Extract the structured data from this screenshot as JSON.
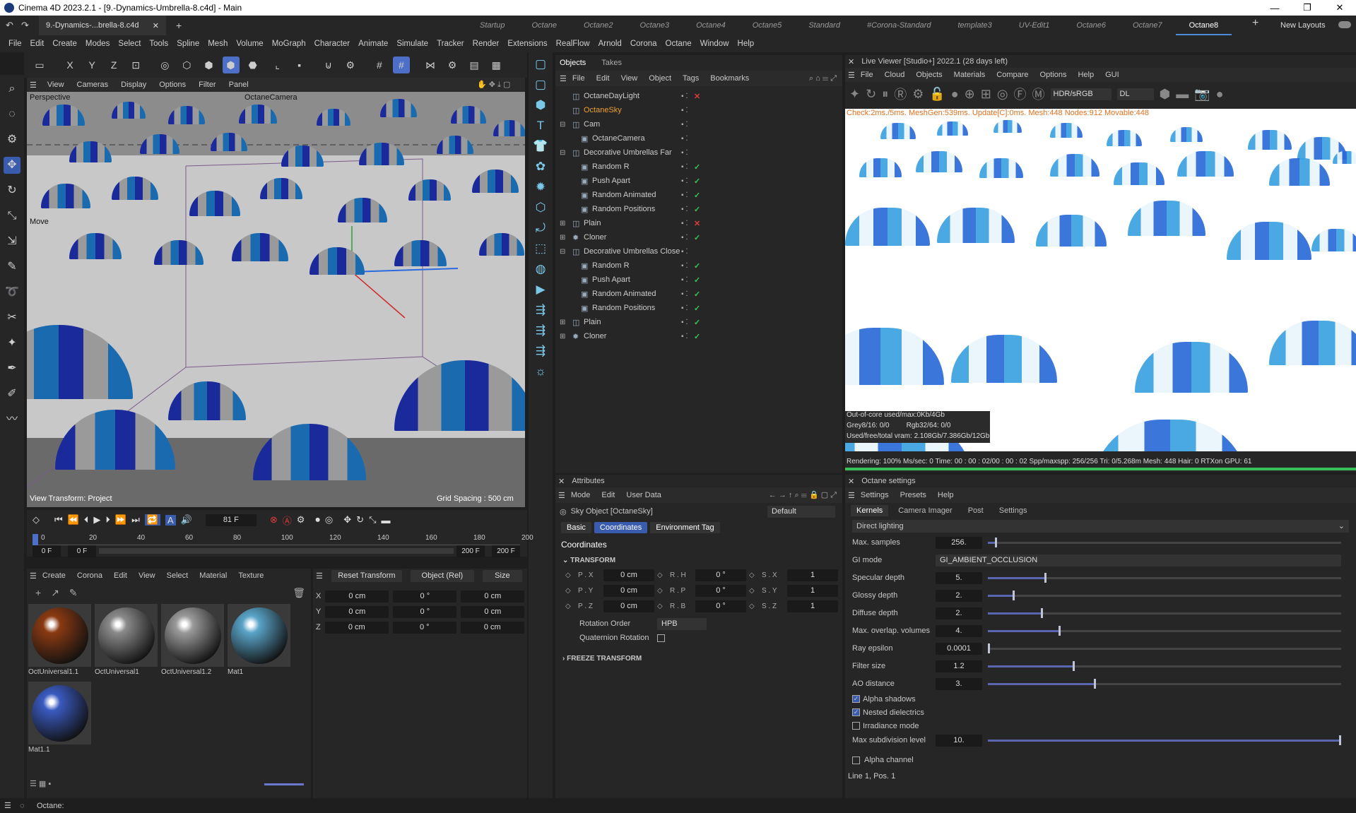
{
  "window": {
    "title": "Cinema 4D 2023.2.1 - [9.-Dynamics-Umbrella-8.c4d] - Main",
    "min": "—",
    "max": "❐",
    "close": "✕"
  },
  "doc_tab": {
    "label": "9.-Dynamics-...brella-8.c4d",
    "close": "✕",
    "add": "+"
  },
  "layout_tabs": [
    "Startup",
    "Octane",
    "Octane2",
    "Octane3",
    "Octane4",
    "Octane5",
    "Standard",
    "#Corona-Standard",
    "template3",
    "UV-Edit1",
    "Octane6",
    "Octane7",
    "Octane8"
  ],
  "layout_active": "Octane8",
  "new_layouts": "New Layouts",
  "menu": [
    "File",
    "Edit",
    "Create",
    "Modes",
    "Select",
    "Tools",
    "Spline",
    "Mesh",
    "Volume",
    "MoGraph",
    "Character",
    "Animate",
    "Simulate",
    "Tracker",
    "Render",
    "Extensions",
    "RealFlow",
    "Arnold",
    "Corona",
    "Octane",
    "Window",
    "Help"
  ],
  "viewport": {
    "menu": [
      "View",
      "Cameras",
      "Display",
      "Options",
      "Filter",
      "Panel"
    ],
    "name": "Perspective",
    "camera": "OctaneCamera",
    "mode": "Move",
    "transform": "View Transform: Project",
    "grid": "Grid Spacing : 500 cm"
  },
  "timeline": {
    "frame": "81 F",
    "ticks": [
      "0",
      "20",
      "40",
      "60",
      "80",
      "100",
      "120",
      "140",
      "160",
      "180",
      "200"
    ],
    "start": "0 F",
    "start2": "0 F",
    "end": "200 F",
    "end2": "200 F"
  },
  "material_menu": [
    "Create",
    "Corona",
    "Edit",
    "View",
    "Select",
    "Material",
    "Texture"
  ],
  "materials": [
    {
      "name": "OctUniversal1.1",
      "color": "#8a3a12"
    },
    {
      "name": "OctUniversal1",
      "color": "#8a8a8a"
    },
    {
      "name": "OctUniversal1.2",
      "color": "#9a9a9a"
    },
    {
      "name": "Mat1",
      "color": "#5aa4c8"
    },
    {
      "name": "Mat1.1",
      "color": "#3a5ac0"
    }
  ],
  "coords": {
    "reset": "Reset Transform",
    "mode": "Object (Rel)",
    "size": "Size",
    "rows": [
      {
        "axis": "X",
        "a": "0 cm",
        "b": "0 °",
        "c": "0 cm"
      },
      {
        "axis": "Y",
        "a": "0 cm",
        "b": "0 °",
        "c": "0 cm"
      },
      {
        "axis": "Z",
        "a": "0 cm",
        "b": "0 °",
        "c": "0 cm"
      }
    ]
  },
  "objects_panel": {
    "tabs": [
      "Objects",
      "Takes"
    ],
    "menu": [
      "File",
      "Edit",
      "View",
      "Object",
      "Tags",
      "Bookmarks"
    ],
    "items": [
      {
        "name": "OctaneDayLight",
        "indent": 0,
        "tag": "x",
        "color": "#ccc"
      },
      {
        "name": "OctaneSky",
        "indent": 0,
        "tag": "",
        "color": "#f0a030"
      },
      {
        "name": "Cam",
        "indent": 0,
        "tag": "",
        "color": "#ccc"
      },
      {
        "name": "OctaneCamera",
        "indent": 1,
        "tag": "",
        "color": "#ccc"
      },
      {
        "name": "Decorative Umbrellas Far",
        "indent": 0,
        "tag": "",
        "color": "#ccc"
      },
      {
        "name": "Random R",
        "indent": 1,
        "tag": "check",
        "color": "#ccc"
      },
      {
        "name": "Push Apart",
        "indent": 1,
        "tag": "check",
        "color": "#ccc"
      },
      {
        "name": "Random Animated",
        "indent": 1,
        "tag": "check",
        "color": "#ccc"
      },
      {
        "name": "Random Positions",
        "indent": 1,
        "tag": "check",
        "color": "#ccc"
      },
      {
        "name": "Plain",
        "indent": 0,
        "tag": "x",
        "color": "#ccc"
      },
      {
        "name": "Cloner",
        "indent": 0,
        "tag": "check",
        "color": "#ccc"
      },
      {
        "name": "Decorative Umbrellas Close",
        "indent": 0,
        "tag": "",
        "color": "#ccc"
      },
      {
        "name": "Random R",
        "indent": 1,
        "tag": "check",
        "color": "#ccc"
      },
      {
        "name": "Push Apart",
        "indent": 1,
        "tag": "check",
        "color": "#ccc"
      },
      {
        "name": "Random Animated",
        "indent": 1,
        "tag": "check",
        "color": "#ccc"
      },
      {
        "name": "Random Positions",
        "indent": 1,
        "tag": "check",
        "color": "#ccc"
      },
      {
        "name": "Plain",
        "indent": 0,
        "tag": "check",
        "color": "#ccc"
      },
      {
        "name": "Cloner",
        "indent": 0,
        "tag": "check",
        "color": "#ccc"
      }
    ]
  },
  "attributes": {
    "title": "Attributes",
    "menu": [
      "Mode",
      "Edit",
      "User Data"
    ],
    "object": "Sky Object [OctaneSky]",
    "preset": "Default",
    "tabs": [
      "Basic",
      "Coordinates",
      "Environment Tag"
    ],
    "section": "Coordinates",
    "group": "TRANSFORM",
    "rows": [
      {
        "p": "P . X",
        "pv": "0 cm",
        "r": "R . H",
        "rv": "0 °",
        "s": "S . X",
        "sv": "1"
      },
      {
        "p": "P . Y",
        "pv": "0 cm",
        "r": "R . P",
        "rv": "0 °",
        "s": "S . Y",
        "sv": "1"
      },
      {
        "p": "P . Z",
        "pv": "0 cm",
        "r": "R . B",
        "rv": "0 °",
        "s": "S . Z",
        "sv": "1"
      }
    ],
    "rotation_order_label": "Rotation Order",
    "rotation_order": "HPB",
    "quaternion": "Quaternion Rotation",
    "freeze": "FREEZE TRANSFORM"
  },
  "live_viewer": {
    "title": "Live Viewer [Studio+] 2022.1 (28 days left)",
    "menu": [
      "File",
      "Cloud",
      "Objects",
      "Materials",
      "Compare",
      "Options",
      "Help",
      "GUI"
    ],
    "color_space": "HDR/sRGB",
    "kernel": "DL",
    "stats_line": "Check:2ms./5ms. MeshGen:539ms. Update[C]:0ms. Mesh:448 Nodes:912 Movable:448",
    "ooc": "Out-of-core used/max:0Kb/4Gb",
    "grey": "Grey8/16: 0/0",
    "rgb": "Rgb32/64: 0/0",
    "vram": "Used/free/total vram: 2.108Gb/7.386Gb/12Gb",
    "status": "Rendering: 100%  Ms/sec: 0   Time: 00 : 00 : 02/00 : 00 : 02  Spp/maxspp: 256/256   Tri: 0/5.268m   Mesh: 448   Hair: 0   RTXon     GPU:       61"
  },
  "octane_settings": {
    "title": "Octane settings",
    "menu": [
      "Settings",
      "Presets",
      "Help"
    ],
    "tabs": [
      "Kernels",
      "Camera Imager",
      "Post",
      "Settings"
    ],
    "kernel": "Direct lighting",
    "params": [
      {
        "label": "Max. samples",
        "value": "256.",
        "level": 0.02
      },
      {
        "label": "GI mode",
        "value": "GI_AMBIENT_OCCLUSION",
        "level": -1
      },
      {
        "label": "Specular depth",
        "value": "5.",
        "level": 0.16
      },
      {
        "label": "Glossy depth",
        "value": "2.",
        "level": 0.07
      },
      {
        "label": "Diffuse depth",
        "value": "2.",
        "level": 0.15
      },
      {
        "label": "Max. overlap. volumes",
        "value": "4.",
        "level": 0.2
      },
      {
        "label": "Ray epsilon",
        "value": "0.0001",
        "level": 0.0
      },
      {
        "label": "Filter size",
        "value": "1.2",
        "level": 0.24
      },
      {
        "label": "AO distance",
        "value": "3.",
        "level": 0.3
      }
    ],
    "checks": [
      {
        "label": "Alpha shadows",
        "checked": true
      },
      {
        "label": "Nested dielectrics",
        "checked": true
      },
      {
        "label": "Irradiance mode",
        "checked": false
      }
    ],
    "subdiv_label": "Max subdivision level",
    "subdiv_value": "10.",
    "subdiv_level": 1.0,
    "alpha_channel": "Alpha channel",
    "footer": "Line 1, Pos. 1"
  },
  "statusbar": {
    "text": "Octane:"
  }
}
